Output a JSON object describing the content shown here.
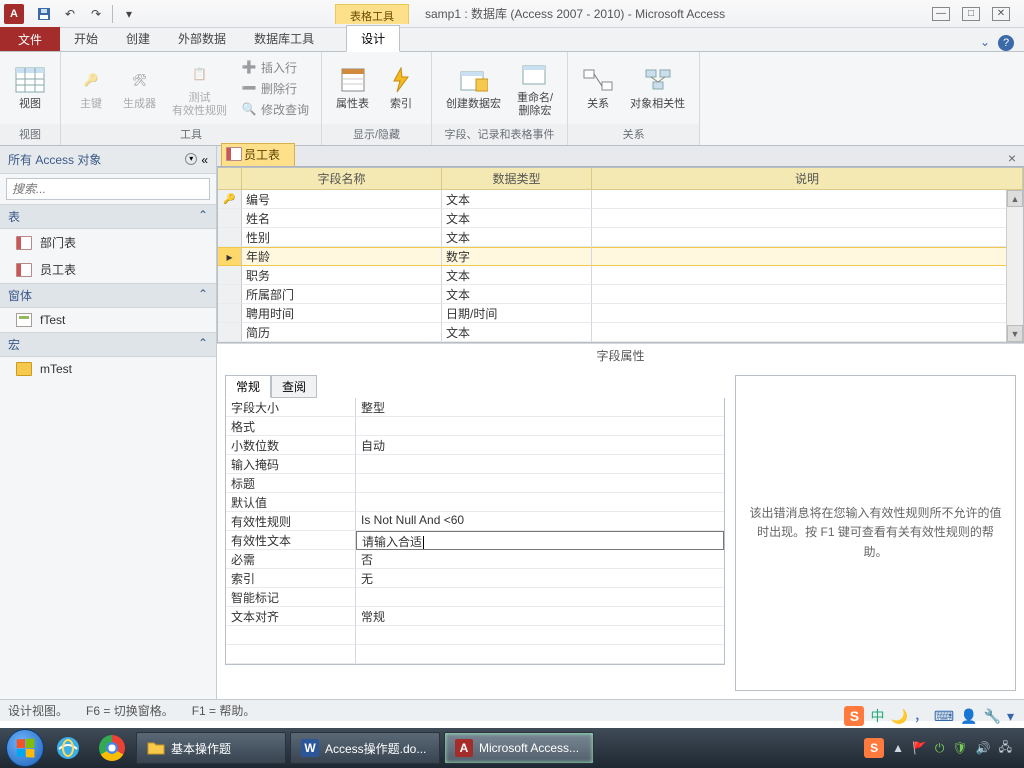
{
  "title": "samp1 : 数据库 (Access 2007 - 2010) - Microsoft Access",
  "tools_contextual": "表格工具",
  "tabs": {
    "file": "文件",
    "home": "开始",
    "create": "创建",
    "external": "外部数据",
    "dbtools": "数据库工具",
    "design": "设计"
  },
  "ribbon": {
    "groups": {
      "view": "视图",
      "tools": "工具",
      "showhide": "显示/隐藏",
      "events": "字段、记录和表格事件",
      "relations": "关系"
    },
    "btns": {
      "view": "视图",
      "pk": "主键",
      "builder": "生成器",
      "testrules": "测试\n有效性规则",
      "insertRow": "插入行",
      "deleteRow": "删除行",
      "modifyQuery": "修改查询",
      "propSheet": "属性表",
      "indexes": "索引",
      "createMacro": "创建数据宏",
      "renameDel": "重命名/\n删除宏",
      "relationships": "关系",
      "objDeps": "对象相关性"
    }
  },
  "nav": {
    "title": "所有 Access 对象",
    "searchPlaceholder": "搜索...",
    "groups": {
      "tables": "表",
      "forms": "窗体",
      "macros": "宏"
    },
    "items": {
      "table1": "部门表",
      "table2": "员工表",
      "form1": "fTest",
      "macro1": "mTest"
    }
  },
  "doc": {
    "tab": "员工表"
  },
  "grid": {
    "headers": {
      "name": "字段名称",
      "type": "数据类型",
      "desc": "说明"
    },
    "rows": [
      {
        "name": "编号",
        "type": "文本",
        "pk": true
      },
      {
        "name": "姓名",
        "type": "文本"
      },
      {
        "name": "性别",
        "type": "文本"
      },
      {
        "name": "年龄",
        "type": "数字",
        "hl": true
      },
      {
        "name": "职务",
        "type": "文本"
      },
      {
        "name": "所属部门",
        "type": "文本"
      },
      {
        "name": "聘用时间",
        "type": "日期/时间"
      },
      {
        "name": "简历",
        "type": "文本"
      }
    ]
  },
  "fieldPropsLabel": "字段属性",
  "fpTabs": {
    "general": "常规",
    "lookup": "查阅"
  },
  "fp": [
    {
      "k": "字段大小",
      "v": "整型"
    },
    {
      "k": "格式",
      "v": ""
    },
    {
      "k": "小数位数",
      "v": "自动"
    },
    {
      "k": "输入掩码",
      "v": ""
    },
    {
      "k": "标题",
      "v": ""
    },
    {
      "k": "默认值",
      "v": ""
    },
    {
      "k": "有效性规则",
      "v": "Is Not Null And <60"
    },
    {
      "k": "有效性文本",
      "v": "请输入合适",
      "editing": true
    },
    {
      "k": "必需",
      "v": "否"
    },
    {
      "k": "索引",
      "v": "无"
    },
    {
      "k": "智能标记",
      "v": ""
    },
    {
      "k": "文本对齐",
      "v": "常规"
    }
  ],
  "helpText": "该出错消息将在您输入有效性规则所不允许的值时出现。按 F1 键可查看有关有效性规则的帮助。",
  "status": {
    "left": "设计视图。",
    "mid": "F6 = 切换窗格。",
    "right": "F1 = 帮助。"
  },
  "taskbar": {
    "items": [
      {
        "label": "基本操作题",
        "type": "folder"
      },
      {
        "label": "Access操作题.do...",
        "type": "word"
      },
      {
        "label": "Microsoft Access...",
        "type": "access",
        "active": true
      }
    ]
  }
}
